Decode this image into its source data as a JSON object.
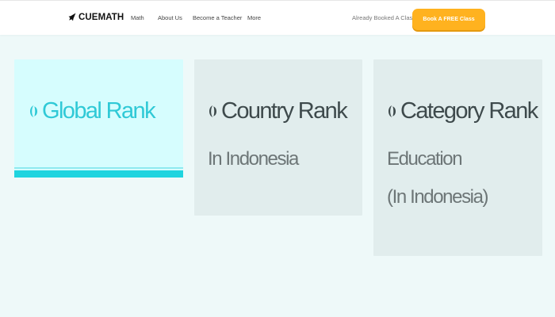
{
  "header": {
    "logo": {
      "icon": "rocket-icon",
      "text": "CUEMATH"
    },
    "nav_links": [
      "Math",
      "About Us",
      "Become a Teacher",
      "More"
    ],
    "already_booked": "Already Booked A Class?",
    "cta_label": "Book A FREE Class"
  },
  "colors": {
    "page_background": "#eef9f9",
    "cta": "#ffb21f",
    "active_card": "#d6fdfe",
    "active_accent": "#1fd4df",
    "inactive_card": "#e1eded"
  },
  "rank_cards": [
    {
      "title": "Global Rank",
      "icon": "globe-icon",
      "active": true,
      "lines": []
    },
    {
      "title": "Country Rank",
      "icon": "flag-icon",
      "active": false,
      "lines": [
        "In Indonesia"
      ]
    },
    {
      "title": "Category Rank",
      "icon": "category-icon",
      "active": false,
      "lines": [
        "Education",
        "(In Indonesia)"
      ]
    }
  ]
}
